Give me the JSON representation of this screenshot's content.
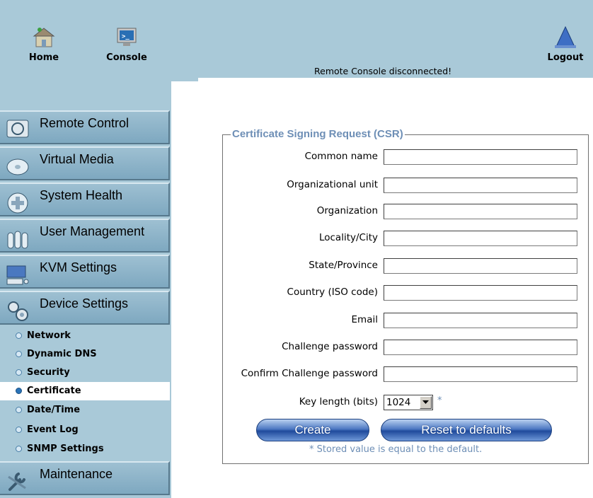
{
  "topbar": {
    "home_label": "Home",
    "console_label": "Console",
    "logout_label": "Logout",
    "status": "Remote Console disconnected!"
  },
  "sidebar": {
    "main_items": [
      {
        "label": "Remote Control",
        "icon": "monitor-icon"
      },
      {
        "label": "Virtual Media",
        "icon": "disk-icon"
      },
      {
        "label": "System Health",
        "icon": "health-cross-icon"
      },
      {
        "label": "User Management",
        "icon": "users-icon"
      },
      {
        "label": "KVM Settings",
        "icon": "keyboard-monitor-icon"
      },
      {
        "label": "Device Settings",
        "icon": "gears-icon"
      }
    ],
    "sub_items": [
      {
        "label": "Network"
      },
      {
        "label": "Dynamic DNS"
      },
      {
        "label": "Security"
      },
      {
        "label": "Certificate",
        "active": true
      },
      {
        "label": "Date/Time"
      },
      {
        "label": "Event Log"
      },
      {
        "label": "SNMP Settings"
      }
    ],
    "maintenance_label": "Maintenance"
  },
  "form": {
    "legend": "Certificate Signing Request (CSR)",
    "fields": [
      {
        "label": "Common name",
        "value": ""
      },
      {
        "label": "Organizational unit",
        "value": ""
      },
      {
        "label": "Organization",
        "value": ""
      },
      {
        "label": "Locality/City",
        "value": ""
      },
      {
        "label": "State/Province",
        "value": ""
      },
      {
        "label": "Country (ISO code)",
        "value": ""
      },
      {
        "label": "Email",
        "value": ""
      },
      {
        "label": "Challenge password",
        "value": ""
      },
      {
        "label": "Confirm Challenge password",
        "value": ""
      }
    ],
    "key_length_label": "Key length (bits)",
    "key_length_value": "1024",
    "asterisk": "*",
    "create_label": "Create",
    "reset_label": "Reset to defaults",
    "note": "* Stored value is equal to the default."
  },
  "colors": {
    "background_band": "#a9c9d8",
    "accent_text": "#6e8fb6",
    "button_blue": "#1f4a9c"
  }
}
